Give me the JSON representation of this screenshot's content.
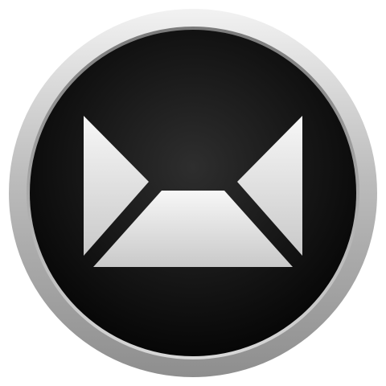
{
  "app_icon": {
    "icon": "mail-envelope-icon",
    "colors": {
      "background": "#ffffff",
      "bezel_light": "#f2f2f2",
      "bezel_mid": "#bdbdbd",
      "bezel_dark": "#8e8e8e",
      "face_center": "#2e2e2e",
      "face_edge": "#050505",
      "glyph_light": "#f7f7f7",
      "glyph_dark": "#c9c9c9"
    }
  }
}
